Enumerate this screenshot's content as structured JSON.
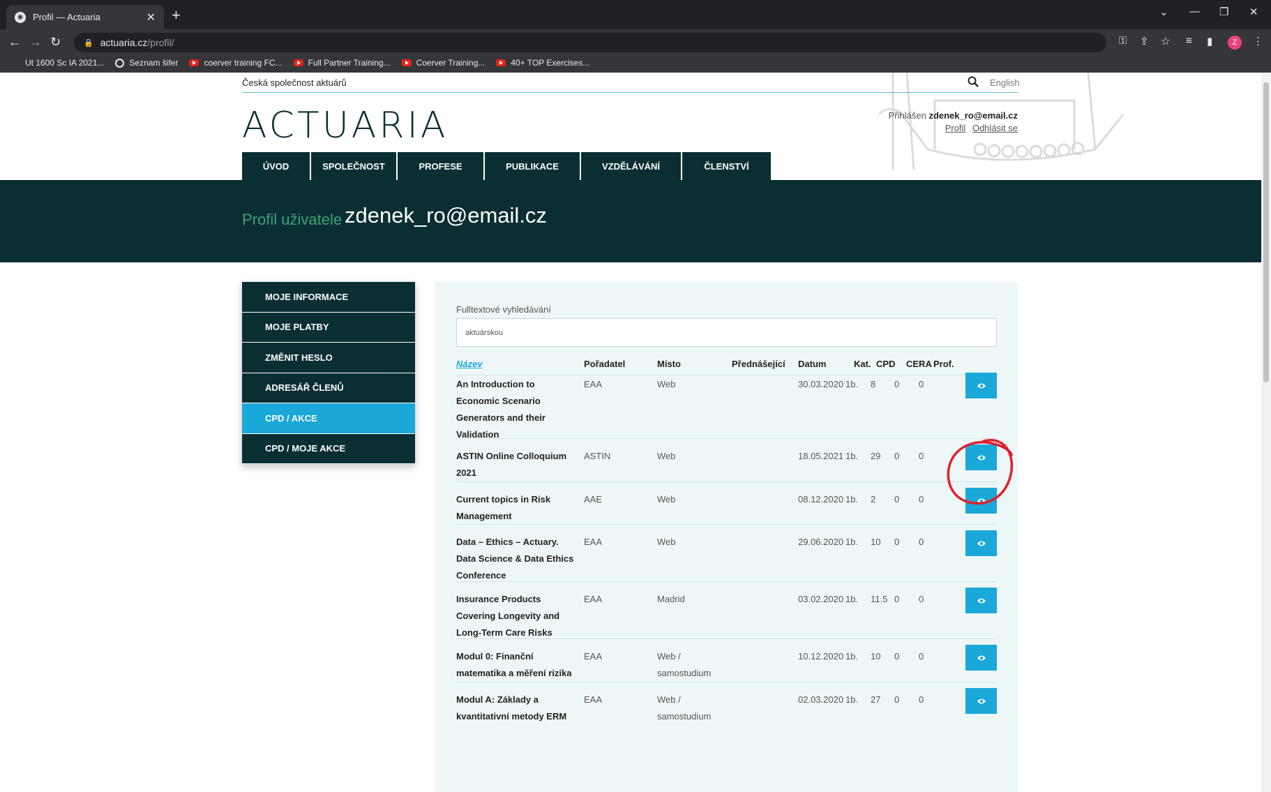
{
  "browser": {
    "tab_title": "Profil — Actuaria",
    "url_host": "actuaria.cz",
    "url_path": "/profil/",
    "bookmarks": [
      "Ut 1600 Sc IA 2021...",
      "Seznam šifer",
      "coerver training FC...",
      "Full Partner Training...",
      "Coerver Training...",
      "40+ TOP Exercises..."
    ],
    "profile_initial": "Z"
  },
  "header": {
    "society_name": "Česká společnost aktuárů",
    "language_link": "English",
    "logo_text": "ACTUARIA",
    "logged_in_label": "Přihlášen",
    "logged_in_user": "zdenek_ro@email.cz",
    "profile_link": "Profil",
    "logout_link": "Odhlásit se"
  },
  "nav": [
    "ÚVOD",
    "SPOLEČNOST",
    "PROFESE",
    "PUBLIKACE",
    "VZDĚLÁVÁNÍ",
    "ČLENSTVÍ"
  ],
  "banner": {
    "label": "Profil uživatele",
    "user": "zdenek_ro@email.cz"
  },
  "sidebar": {
    "items": [
      {
        "label": "MOJE INFORMACE",
        "active": false
      },
      {
        "label": "MOJE PLATBY",
        "active": false
      },
      {
        "label": "ZMĚNIT HESLO",
        "active": false
      },
      {
        "label": "ADRESÁŘ ČLENŮ",
        "active": false
      },
      {
        "label": "CPD / AKCE",
        "active": true
      },
      {
        "label": "CPD / MOJE AKCE",
        "active": false
      }
    ]
  },
  "search": {
    "label": "Fulltextové vyhledávání",
    "value": "aktuárskou"
  },
  "table": {
    "headers": [
      "Název",
      "Pořadatel",
      "Místo",
      "Přednášející",
      "Datum",
      "Kat.",
      "CPD",
      "CERA",
      "Prof."
    ],
    "rows": [
      {
        "name": [
          "An Introduction to",
          "Economic Scenario",
          "Generators and their",
          "Validation"
        ],
        "organizer": "EAA",
        "place": [
          "Web"
        ],
        "speaker": "",
        "date": "30.03.2020",
        "cat": "1b.",
        "cpd": "8",
        "cera": "0",
        "prof": "0"
      },
      {
        "name": [
          "ASTIN Online Colloquium",
          "2021"
        ],
        "organizer": "ASTIN",
        "place": [
          "Web"
        ],
        "speaker": "",
        "date": "18.05.2021",
        "cat": "1b.",
        "cpd": "29",
        "cera": "0",
        "prof": "0"
      },
      {
        "name": [
          "Current topics in Risk",
          "Management"
        ],
        "organizer": "AAE",
        "place": [
          "Web"
        ],
        "speaker": "",
        "date": "08.12.2020",
        "cat": "1b.",
        "cpd": "2",
        "cera": "0",
        "prof": "0"
      },
      {
        "name": [
          "Data – Ethics – Actuary.",
          "Data Science & Data Ethics",
          "Conference"
        ],
        "organizer": "EAA",
        "place": [
          "Web"
        ],
        "speaker": "",
        "date": "29.06.2020",
        "cat": "1b.",
        "cpd": "10",
        "cera": "0",
        "prof": "0"
      },
      {
        "name": [
          "Insurance Products",
          "Covering Longevity and",
          "Long-Term Care Risks"
        ],
        "organizer": "EAA",
        "place": [
          "Madrid"
        ],
        "speaker": "",
        "date": "03.02.2020",
        "cat": "1b.",
        "cpd": "11.5",
        "cera": "0",
        "prof": "0"
      },
      {
        "name": [
          "Modul 0: Finanční",
          "matematika a měření rizika"
        ],
        "organizer": "EAA",
        "place": [
          "Web /",
          "samostudium"
        ],
        "speaker": "",
        "date": "10.12.2020",
        "cat": "1b.",
        "cpd": "10",
        "cera": "0",
        "prof": "0"
      },
      {
        "name": [
          "Modul A: Základy a",
          "kvantitativní metody ERM"
        ],
        "organizer": "EAA",
        "place": [
          "Web /",
          "samostudium"
        ],
        "speaker": "",
        "date": "02.03.2020",
        "cat": "1b.",
        "cpd": "27",
        "cera": "0",
        "prof": "0"
      }
    ]
  },
  "colors": {
    "dark_teal": "#0a2f33",
    "accent_blue": "#1aa8d8",
    "label_green": "#3aa37a",
    "panel_bg": "#eef7f8",
    "annotation_red": "#e0202a"
  },
  "icons": {
    "view_button": "eye-icon",
    "header_search": "search-icon",
    "annotation": "red-circle-annotation"
  }
}
